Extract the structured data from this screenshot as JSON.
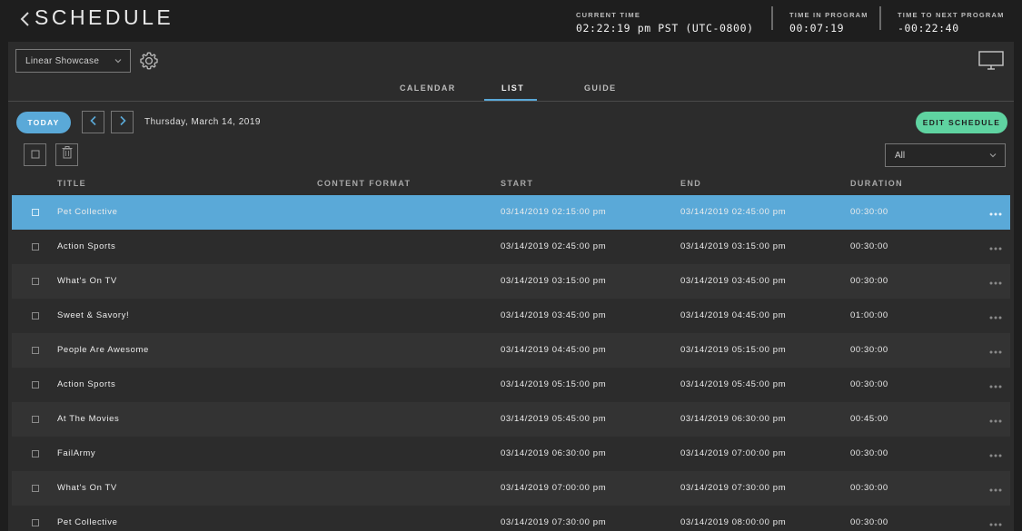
{
  "header": {
    "title": "SCHEDULE",
    "current_time_label": "CURRENT TIME",
    "current_time_value": "02:22:19 pm PST (UTC-0800)",
    "time_in_program_label": "TIME IN PROGRAM",
    "time_in_program_value": "00:07:19",
    "time_to_next_label": "TIME TO NEXT PROGRAM",
    "time_to_next_value": "-00:22:40"
  },
  "channel_select": {
    "value": "Linear Showcase"
  },
  "tabs": [
    {
      "label": "CALENDAR",
      "active": false
    },
    {
      "label": "LIST",
      "active": true
    },
    {
      "label": "GUIDE",
      "active": false
    }
  ],
  "nav": {
    "today_label": "TODAY",
    "date": "Thursday, March 14, 2019",
    "edit_label": "EDIT SCHEDULE"
  },
  "filter": {
    "value": "All"
  },
  "table": {
    "columns": [
      "TITLE",
      "CONTENT FORMAT",
      "START",
      "END",
      "DURATION"
    ],
    "rows": [
      {
        "title": "Pet Collective",
        "format": "",
        "start": "03/14/2019 02:15:00 pm",
        "end": "03/14/2019 02:45:00 pm",
        "duration": "00:30:00",
        "selected": true
      },
      {
        "title": "Action Sports",
        "format": "",
        "start": "03/14/2019 02:45:00 pm",
        "end": "03/14/2019 03:15:00 pm",
        "duration": "00:30:00"
      },
      {
        "title": "What's On TV",
        "format": "",
        "start": "03/14/2019 03:15:00 pm",
        "end": "03/14/2019 03:45:00 pm",
        "duration": "00:30:00"
      },
      {
        "title": "Sweet & Savory!",
        "format": "",
        "start": "03/14/2019 03:45:00 pm",
        "end": "03/14/2019 04:45:00 pm",
        "duration": "01:00:00"
      },
      {
        "title": "People Are Awesome",
        "format": "",
        "start": "03/14/2019 04:45:00 pm",
        "end": "03/14/2019 05:15:00 pm",
        "duration": "00:30:00"
      },
      {
        "title": "Action Sports",
        "format": "",
        "start": "03/14/2019 05:15:00 pm",
        "end": "03/14/2019 05:45:00 pm",
        "duration": "00:30:00"
      },
      {
        "title": "At The Movies",
        "format": "",
        "start": "03/14/2019 05:45:00 pm",
        "end": "03/14/2019 06:30:00 pm",
        "duration": "00:45:00"
      },
      {
        "title": "FailArmy",
        "format": "",
        "start": "03/14/2019 06:30:00 pm",
        "end": "03/14/2019 07:00:00 pm",
        "duration": "00:30:00"
      },
      {
        "title": "What's On TV",
        "format": "",
        "start": "03/14/2019 07:00:00 pm",
        "end": "03/14/2019 07:30:00 pm",
        "duration": "00:30:00"
      },
      {
        "title": "Pet Collective",
        "format": "",
        "start": "03/14/2019 07:30:00 pm",
        "end": "03/14/2019 08:00:00 pm",
        "duration": "00:30:00"
      }
    ]
  },
  "colors": {
    "accent_blue": "#5aa9d8",
    "accent_green": "#5fd3a1",
    "background": "#1e1e1e",
    "panel": "#2c2c2c"
  },
  "icons": [
    "back-chevron-icon",
    "chevron-down-icon",
    "gear-icon",
    "monitor-icon",
    "chevron-left-icon",
    "chevron-right-icon",
    "checkbox-icon",
    "trash-icon",
    "more-dots-icon"
  ]
}
